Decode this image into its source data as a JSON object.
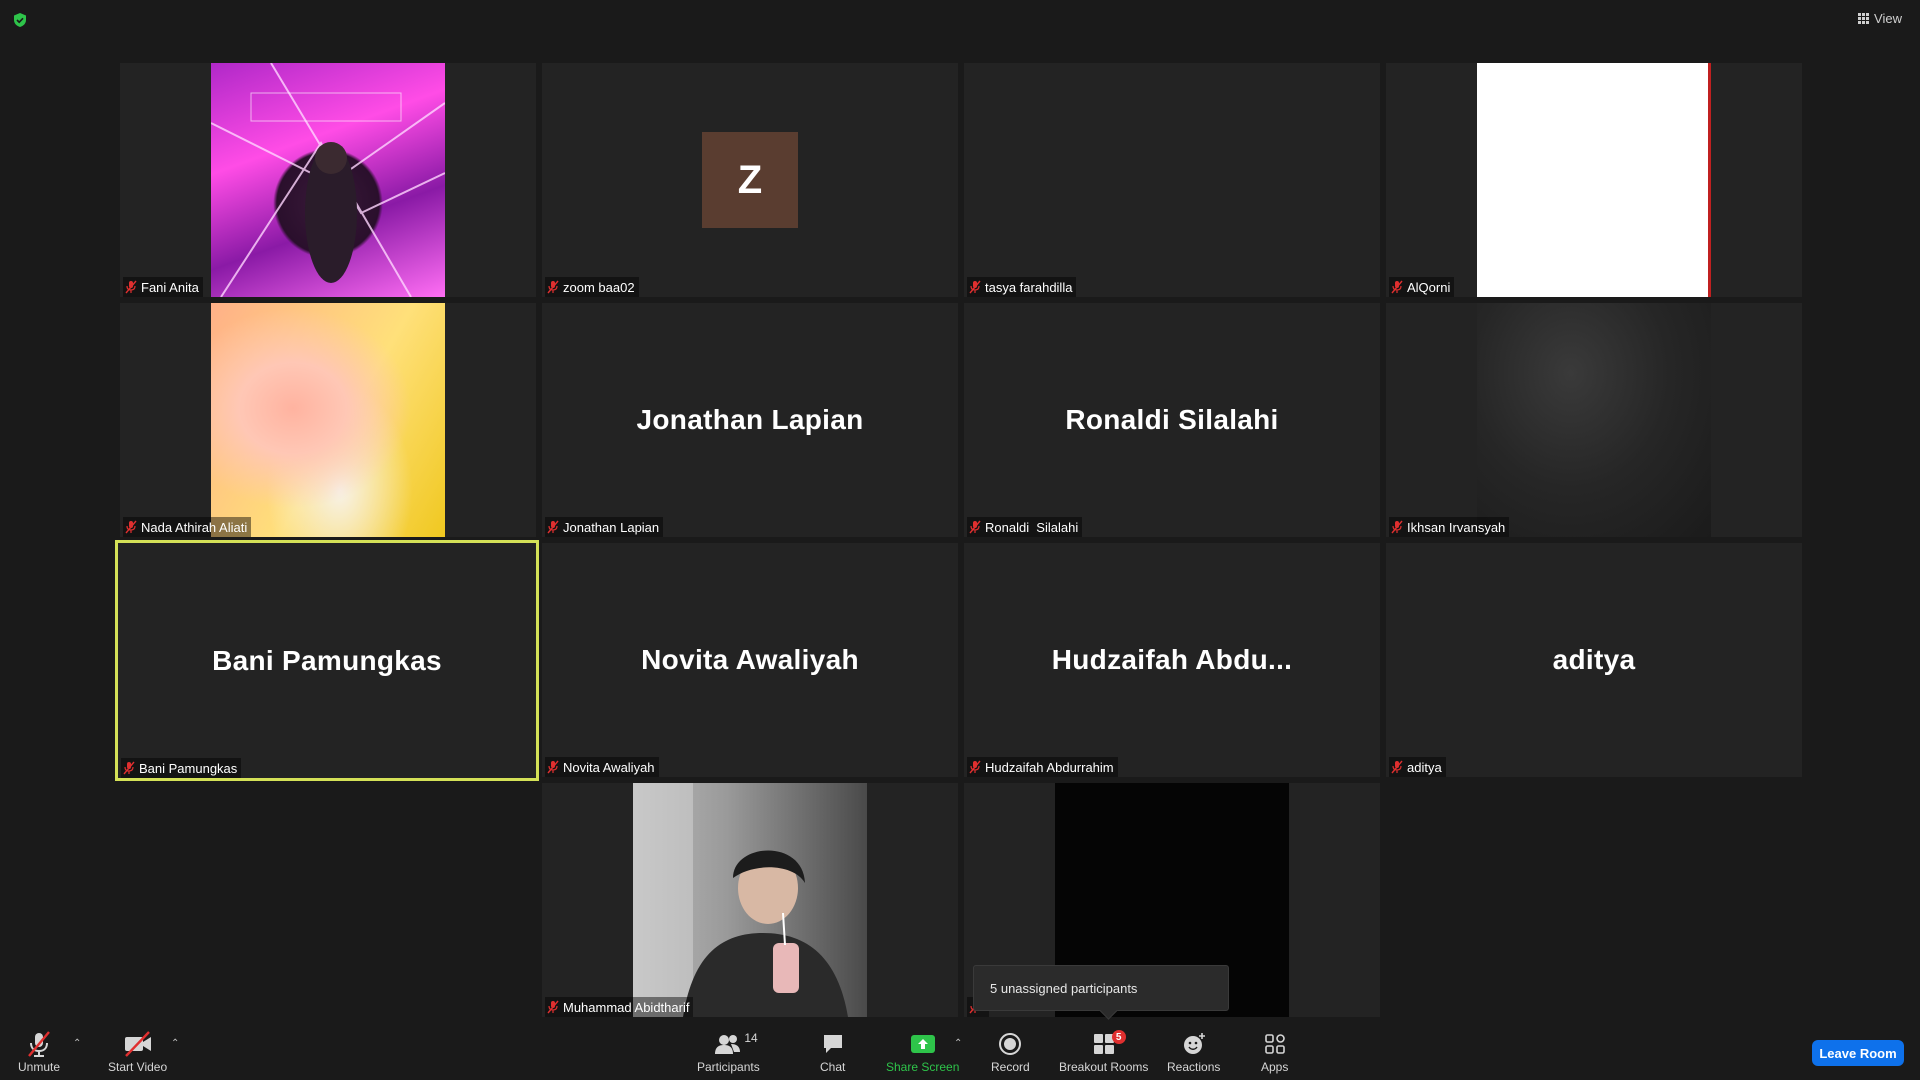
{
  "top_bar": {
    "view_label": "View"
  },
  "tiles": [
    {
      "name": "Fani Anita",
      "mode": "video"
    },
    {
      "name": "zoom baa02",
      "mode": "avatar",
      "initial": "Z"
    },
    {
      "name": "tasya farahdilla",
      "mode": "blank"
    },
    {
      "name": "AlQorni",
      "mode": "video"
    },
    {
      "name": "Nada Athirah Aliati",
      "mode": "video"
    },
    {
      "name": "Jonathan Lapian",
      "mode": "name",
      "display": "Jonathan Lapian"
    },
    {
      "name": "Ronaldi  Silalahi",
      "mode": "name",
      "display": "Ronaldi  Silalahi"
    },
    {
      "name": "Ikhsan Irvansyah",
      "mode": "video"
    },
    {
      "name": "Bani Pamungkas",
      "mode": "name",
      "display": "Bani Pamungkas",
      "active": true
    },
    {
      "name": "Novita Awaliyah",
      "mode": "name",
      "display": "Novita Awaliyah"
    },
    {
      "name": "Hudzaifah Abdurrahim",
      "mode": "name",
      "display": "Hudzaifah  Abdu..."
    },
    {
      "name": "aditya",
      "mode": "name",
      "display": "aditya"
    },
    {
      "name": "Muhammad Abidtharif",
      "mode": "video"
    },
    {
      "name": "",
      "mode": "video"
    }
  ],
  "tooltip": {
    "text": "5 unassigned participants"
  },
  "toolbar": {
    "unmute": "Unmute",
    "start_video": "Start Video",
    "participants": "Participants",
    "participants_count": "14",
    "chat": "Chat",
    "share_screen": "Share Screen",
    "record": "Record",
    "breakout_rooms": "Breakout Rooms",
    "breakout_badge": "5",
    "reactions": "Reactions",
    "apps": "Apps",
    "leave_room": "Leave Room"
  },
  "colors": {
    "active_speaker_border": "#d4e157",
    "share_screen_green": "#2ec44a",
    "leave_blue": "#0e71eb",
    "muted_red": "#e02f2f"
  }
}
